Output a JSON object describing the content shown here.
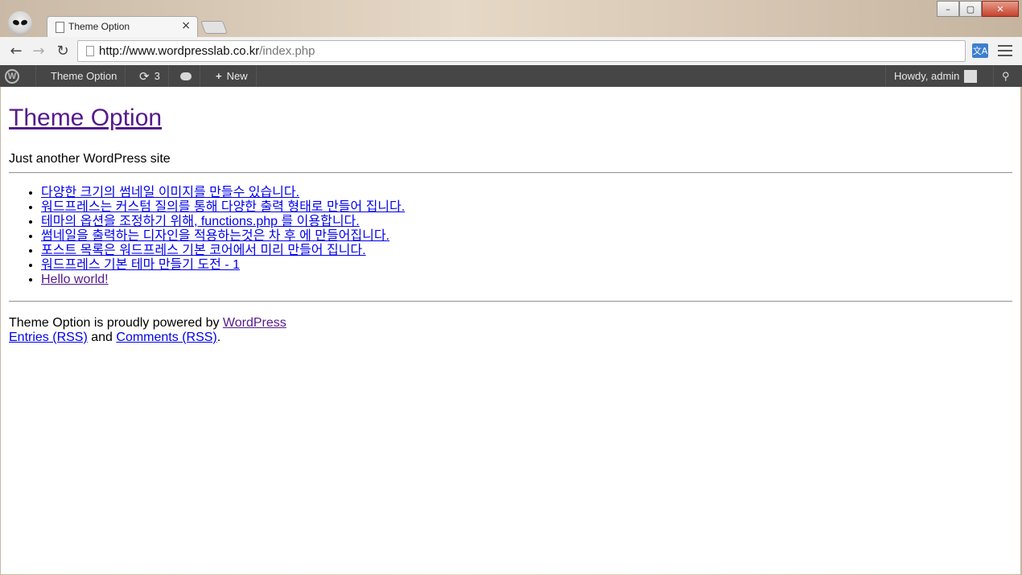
{
  "browser": {
    "tab_title": "Theme Option",
    "tab_close": "×",
    "url_host": "http://www.wordpresslab.co.kr",
    "url_path": "/index.php",
    "window_buttons": {
      "minimize": "–",
      "maximize": "▢",
      "close": "✕"
    },
    "icons": {
      "back": "back-arrow-icon",
      "forward": "forward-arrow-icon",
      "reload": "reload-icon",
      "translate": "translate-icon",
      "menu": "menu-icon"
    }
  },
  "admin_bar": {
    "site_name": "Theme Option",
    "updates_count": "3",
    "new_label": "New",
    "howdy": "Howdy, admin"
  },
  "page": {
    "site_title": "Theme Option",
    "tagline": "Just another WordPress site",
    "posts": [
      "다양한 크기의 썸네일 이미지를 만들수 있습니다.",
      "워드프레스는 커스텀 질의를 통해 다양한 출력 형태로 만들어 집니다.",
      "테마의 옵션을 조정하기 위해, functions.php 를 이용합니다.",
      "썸네일을 출력하는 디자인을 적용하는것은 차 후 에 만들어집니다.",
      "포스트 목록은 워드프레스 기본 코어에서 미리 만들어 집니다.",
      "워드프레스 기본 테마 만들기 도전 - 1",
      "Hello world!"
    ],
    "footer": {
      "powered_text": "Theme Option is proudly powered by ",
      "wordpress_link": "WordPress",
      "entries_rss": "Entries (RSS)",
      "and_text": " and ",
      "comments_rss": "Comments (RSS)",
      "end_period": "."
    }
  }
}
